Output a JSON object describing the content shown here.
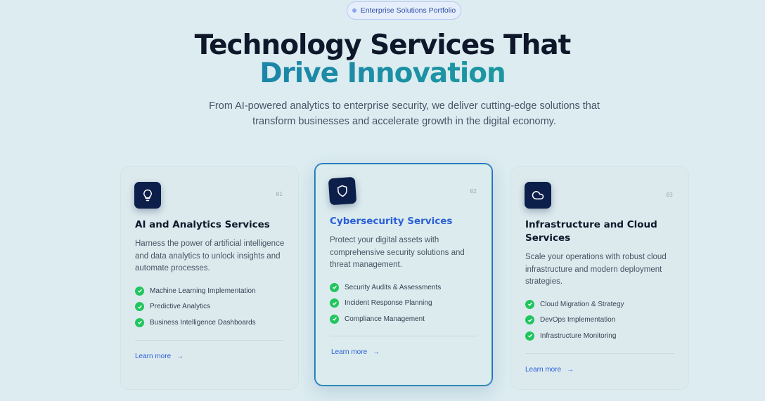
{
  "badge": {
    "label": "Enterprise Solutions Portfolio"
  },
  "hero": {
    "title_line1": "Technology Services That",
    "title_line2": "Drive Innovation",
    "subtitle": "From AI-powered analytics to enterprise security, we deliver cutting-edge solutions that transform businesses and accelerate growth in the digital economy."
  },
  "colors": {
    "accent": "#2a5fd6",
    "icon_bg": "#0c1e4a",
    "check": "#22c55e",
    "gradient_start": "#1f6fae",
    "gradient_end": "#23a08f"
  },
  "cards": [
    {
      "number": "01",
      "icon": "lightbulb-icon",
      "title": "AI and Analytics Services",
      "description": "Harness the power of artificial intelligence and data analytics to unlock insights and automate processes.",
      "features": [
        "Machine Learning Implementation",
        "Predictive Analytics",
        "Business Intelligence Dashboards"
      ],
      "link": "Learn more",
      "arrow": "→"
    },
    {
      "number": "02",
      "icon": "shield-icon",
      "title": "Cybersecurity Services",
      "description": "Protect your digital assets with comprehensive security solutions and threat management.",
      "features": [
        "Security Audits & Assessments",
        "Incident Response Planning",
        "Compliance Management"
      ],
      "link": "Learn more",
      "arrow": "→"
    },
    {
      "number": "03",
      "icon": "cloud-icon",
      "title": "Infrastructure and Cloud Services",
      "description": "Scale your operations with robust cloud infrastructure and modern deployment strategies.",
      "features": [
        "Cloud Migration & Strategy",
        "DevOps Implementation",
        "Infrastructure Monitoring"
      ],
      "link": "Learn more",
      "arrow": "→"
    }
  ]
}
